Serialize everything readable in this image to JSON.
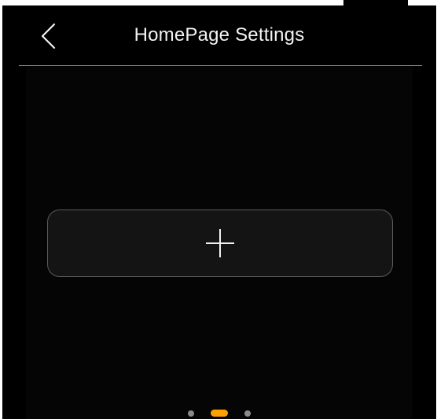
{
  "header": {
    "title": "HomePage Settings",
    "back_icon": "chevron-left-icon"
  },
  "main": {
    "add_button_icon": "plus-icon"
  },
  "pager": {
    "page_count": 3,
    "current_page": 2
  },
  "colors": {
    "background": "#000000",
    "card_background": "#141414",
    "card_border": "#5a5a5a",
    "text": "#f2f2f2",
    "accent": "#ffa000",
    "inactive_dot": "#8a8a8a"
  }
}
